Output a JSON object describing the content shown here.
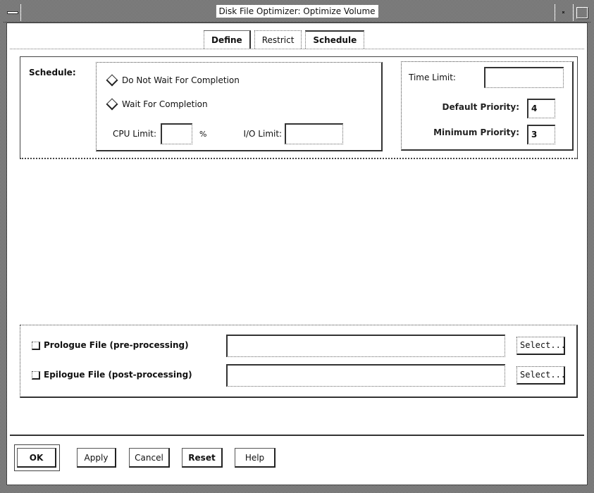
{
  "window": {
    "title": "Disk File Optimizer: Optimize Volume"
  },
  "tabs": [
    {
      "label": "Define",
      "active": false
    },
    {
      "label": "Restrict",
      "active": false
    },
    {
      "label": "Schedule",
      "active": true
    }
  ],
  "schedule": {
    "section_label": "Schedule:",
    "completion_options": [
      {
        "label": "Do Not Wait For Completion",
        "selected": false
      },
      {
        "label": "Wait For Completion",
        "selected": false
      }
    ],
    "cpu_limit": {
      "label": "CPU Limit:",
      "value": "",
      "unit": "%"
    },
    "io_limit": {
      "label": "I/O Limit:",
      "value": ""
    },
    "time_limit": {
      "label": "Time Limit:",
      "value": ""
    },
    "default_priority": {
      "label": "Default Priority:",
      "value": "4"
    },
    "minimum_priority": {
      "label": "Minimum Priority:",
      "value": "3"
    }
  },
  "files": [
    {
      "label": "Prologue File (pre-processing)",
      "checked": false,
      "value": "",
      "button": "Select..."
    },
    {
      "label": "Epilogue File (post-processing)",
      "checked": false,
      "value": "",
      "button": "Select..."
    }
  ],
  "buttons": {
    "ok": "OK",
    "apply": "Apply",
    "cancel": "Cancel",
    "reset": "Reset",
    "help": "Help"
  }
}
